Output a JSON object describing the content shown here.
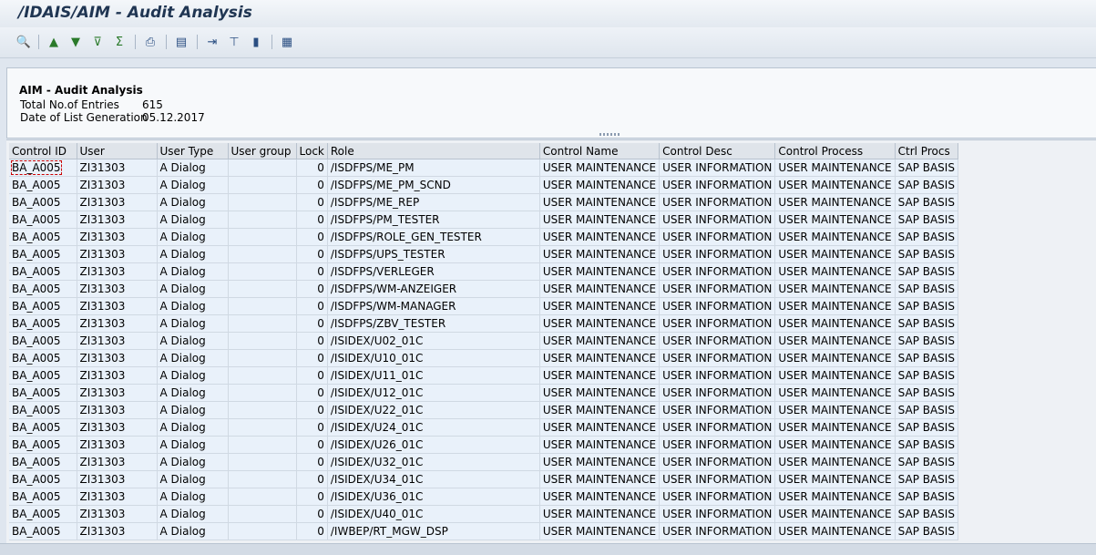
{
  "window": {
    "title": "/IDAIS/AIM - Audit Analysis"
  },
  "toolbar": {
    "buttons": [
      {
        "name": "details-icon",
        "glyph": "🔍"
      },
      {
        "name": "sort-ascending-icon",
        "glyph": "▲"
      },
      {
        "name": "sort-descending-icon",
        "glyph": "▼"
      },
      {
        "name": "filter-icon",
        "glyph": "⊽"
      },
      {
        "name": "sum-icon",
        "glyph": "Σ"
      },
      {
        "name": "print-preview-icon",
        "glyph": "⎙"
      },
      {
        "name": "export-icon",
        "glyph": "▤"
      },
      {
        "name": "local-file-icon",
        "glyph": "⇥"
      },
      {
        "name": "select-layout-icon",
        "glyph": "⊤"
      },
      {
        "name": "graphic-icon",
        "glyph": "▮"
      },
      {
        "name": "layout-icon",
        "glyph": "▦"
      }
    ]
  },
  "header": {
    "title": "AIM - Audit Analysis",
    "rows": [
      {
        "label": "Total No.of Entries",
        "value": "615"
      },
      {
        "label": "Date of List Generation",
        "value": "05.12.2017"
      }
    ]
  },
  "grid": {
    "columns": [
      "Control ID",
      "User",
      "User Type",
      "User group",
      "Lock",
      "Role",
      "Control Name",
      "Control Desc",
      "Control Process",
      "Ctrl Procs"
    ],
    "rows": [
      [
        "BA_A005",
        "ZI31303",
        "A Dialog",
        "",
        "0",
        "/ISDFPS/ME_PM",
        "USER MAINTENANCE",
        "USER INFORMATION",
        "USER MAINTENANCE",
        "SAP BASIS"
      ],
      [
        "BA_A005",
        "ZI31303",
        "A Dialog",
        "",
        "0",
        "/ISDFPS/ME_PM_SCND",
        "USER MAINTENANCE",
        "USER INFORMATION",
        "USER MAINTENANCE",
        "SAP BASIS"
      ],
      [
        "BA_A005",
        "ZI31303",
        "A Dialog",
        "",
        "0",
        "/ISDFPS/ME_REP",
        "USER MAINTENANCE",
        "USER INFORMATION",
        "USER MAINTENANCE",
        "SAP BASIS"
      ],
      [
        "BA_A005",
        "ZI31303",
        "A Dialog",
        "",
        "0",
        "/ISDFPS/PM_TESTER",
        "USER MAINTENANCE",
        "USER INFORMATION",
        "USER MAINTENANCE",
        "SAP BASIS"
      ],
      [
        "BA_A005",
        "ZI31303",
        "A Dialog",
        "",
        "0",
        "/ISDFPS/ROLE_GEN_TESTER",
        "USER MAINTENANCE",
        "USER INFORMATION",
        "USER MAINTENANCE",
        "SAP BASIS"
      ],
      [
        "BA_A005",
        "ZI31303",
        "A Dialog",
        "",
        "0",
        "/ISDFPS/UPS_TESTER",
        "USER MAINTENANCE",
        "USER INFORMATION",
        "USER MAINTENANCE",
        "SAP BASIS"
      ],
      [
        "BA_A005",
        "ZI31303",
        "A Dialog",
        "",
        "0",
        "/ISDFPS/VERLEGER",
        "USER MAINTENANCE",
        "USER INFORMATION",
        "USER MAINTENANCE",
        "SAP BASIS"
      ],
      [
        "BA_A005",
        "ZI31303",
        "A Dialog",
        "",
        "0",
        "/ISDFPS/WM-ANZEIGER",
        "USER MAINTENANCE",
        "USER INFORMATION",
        "USER MAINTENANCE",
        "SAP BASIS"
      ],
      [
        "BA_A005",
        "ZI31303",
        "A Dialog",
        "",
        "0",
        "/ISDFPS/WM-MANAGER",
        "USER MAINTENANCE",
        "USER INFORMATION",
        "USER MAINTENANCE",
        "SAP BASIS"
      ],
      [
        "BA_A005",
        "ZI31303",
        "A Dialog",
        "",
        "0",
        "/ISDFPS/ZBV_TESTER",
        "USER MAINTENANCE",
        "USER INFORMATION",
        "USER MAINTENANCE",
        "SAP BASIS"
      ],
      [
        "BA_A005",
        "ZI31303",
        "A Dialog",
        "",
        "0",
        "/ISIDEX/U02_01C",
        "USER MAINTENANCE",
        "USER INFORMATION",
        "USER MAINTENANCE",
        "SAP BASIS"
      ],
      [
        "BA_A005",
        "ZI31303",
        "A Dialog",
        "",
        "0",
        "/ISIDEX/U10_01C",
        "USER MAINTENANCE",
        "USER INFORMATION",
        "USER MAINTENANCE",
        "SAP BASIS"
      ],
      [
        "BA_A005",
        "ZI31303",
        "A Dialog",
        "",
        "0",
        "/ISIDEX/U11_01C",
        "USER MAINTENANCE",
        "USER INFORMATION",
        "USER MAINTENANCE",
        "SAP BASIS"
      ],
      [
        "BA_A005",
        "ZI31303",
        "A Dialog",
        "",
        "0",
        "/ISIDEX/U12_01C",
        "USER MAINTENANCE",
        "USER INFORMATION",
        "USER MAINTENANCE",
        "SAP BASIS"
      ],
      [
        "BA_A005",
        "ZI31303",
        "A Dialog",
        "",
        "0",
        "/ISIDEX/U22_01C",
        "USER MAINTENANCE",
        "USER INFORMATION",
        "USER MAINTENANCE",
        "SAP BASIS"
      ],
      [
        "BA_A005",
        "ZI31303",
        "A Dialog",
        "",
        "0",
        "/ISIDEX/U24_01C",
        "USER MAINTENANCE",
        "USER INFORMATION",
        "USER MAINTENANCE",
        "SAP BASIS"
      ],
      [
        "BA_A005",
        "ZI31303",
        "A Dialog",
        "",
        "0",
        "/ISIDEX/U26_01C",
        "USER MAINTENANCE",
        "USER INFORMATION",
        "USER MAINTENANCE",
        "SAP BASIS"
      ],
      [
        "BA_A005",
        "ZI31303",
        "A Dialog",
        "",
        "0",
        "/ISIDEX/U32_01C",
        "USER MAINTENANCE",
        "USER INFORMATION",
        "USER MAINTENANCE",
        "SAP BASIS"
      ],
      [
        "BA_A005",
        "ZI31303",
        "A Dialog",
        "",
        "0",
        "/ISIDEX/U34_01C",
        "USER MAINTENANCE",
        "USER INFORMATION",
        "USER MAINTENANCE",
        "SAP BASIS"
      ],
      [
        "BA_A005",
        "ZI31303",
        "A Dialog",
        "",
        "0",
        "/ISIDEX/U36_01C",
        "USER MAINTENANCE",
        "USER INFORMATION",
        "USER MAINTENANCE",
        "SAP BASIS"
      ],
      [
        "BA_A005",
        "ZI31303",
        "A Dialog",
        "",
        "0",
        "/ISIDEX/U40_01C",
        "USER MAINTENANCE",
        "USER INFORMATION",
        "USER MAINTENANCE",
        "SAP BASIS"
      ],
      [
        "BA_A005",
        "ZI31303",
        "A Dialog",
        "",
        "0",
        "/IWBEP/RT_MGW_DSP",
        "USER MAINTENANCE",
        "USER INFORMATION",
        "USER MAINTENANCE",
        "SAP BASIS"
      ]
    ]
  }
}
